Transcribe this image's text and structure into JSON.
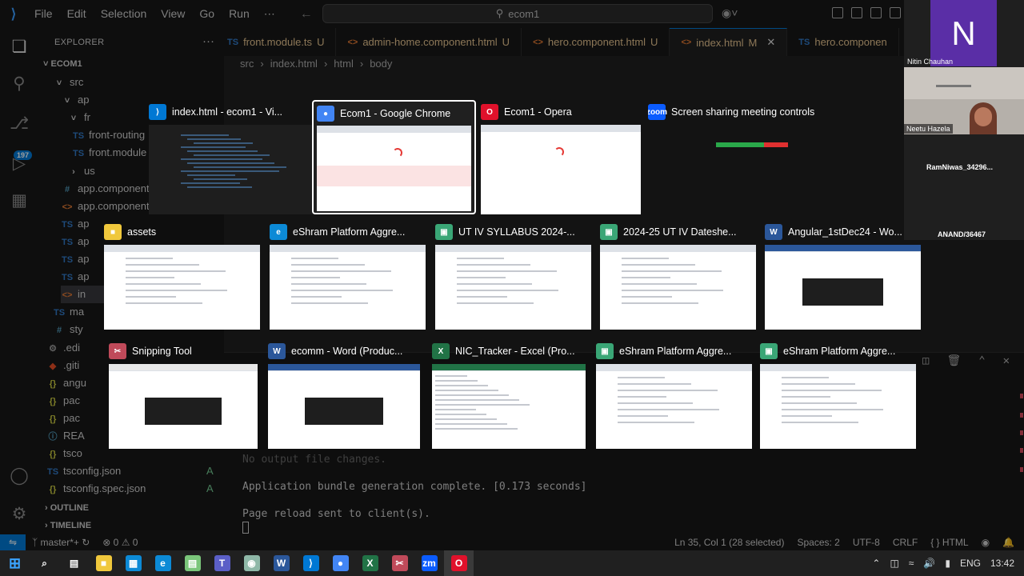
{
  "titlebar": {
    "menu": [
      "File",
      "Edit",
      "Selection",
      "View",
      "Go",
      "Run",
      "⋯"
    ],
    "search": "ecom1"
  },
  "activity": {
    "badge": "197"
  },
  "explorer": {
    "title": "EXPLORER",
    "root": "ECOM1",
    "items": [
      {
        "label": "src",
        "icon": "˅",
        "status": ""
      },
      {
        "label": "ap",
        "icon": "˅",
        "status": ""
      },
      {
        "label": "fr",
        "icon": "˅",
        "status": ""
      },
      {
        "label": "front-routing",
        "icon": "TS",
        "status": ""
      },
      {
        "label": "front.module",
        "icon": "TS",
        "status": ""
      },
      {
        "label": "us",
        "icon": "›",
        "status": ""
      },
      {
        "label": "app.component",
        "icon": "#",
        "status": ""
      },
      {
        "label": "app.component",
        "icon": "<>",
        "status": ""
      },
      {
        "label": "ap",
        "icon": "TS",
        "status": ""
      },
      {
        "label": "ap",
        "icon": "TS",
        "status": ""
      },
      {
        "label": "ap",
        "icon": "TS",
        "status": ""
      },
      {
        "label": "ap",
        "icon": "TS",
        "status": ""
      },
      {
        "label": "in",
        "icon": "<>",
        "status": ""
      },
      {
        "label": "ma",
        "icon": "TS",
        "status": ""
      },
      {
        "label": "sty",
        "icon": "#",
        "status": ""
      },
      {
        "label": ".edi",
        "icon": "⚙",
        "status": ""
      },
      {
        "label": ".giti",
        "icon": "◆",
        "status": ""
      },
      {
        "label": "angu",
        "icon": "{}",
        "status": ""
      },
      {
        "label": "pac",
        "icon": "{}",
        "status": ""
      },
      {
        "label": "pac",
        "icon": "{}",
        "status": ""
      },
      {
        "label": "REA",
        "icon": "ⓘ",
        "status": ""
      },
      {
        "label": "tsco",
        "icon": "{}",
        "status": ""
      },
      {
        "label": "tsconfig.json",
        "icon": "TS",
        "status": "A"
      },
      {
        "label": "tsconfig.spec.json",
        "icon": "{}",
        "status": "A"
      }
    ],
    "outline": "OUTLINE",
    "timeline": "TIMELINE"
  },
  "tabs": [
    {
      "label": "front.module.ts",
      "icon": "TS",
      "status": "U",
      "active": false
    },
    {
      "label": "admin-home.component.html",
      "icon": "<>",
      "status": "U",
      "active": false
    },
    {
      "label": "hero.component.html",
      "icon": "<>",
      "status": "U",
      "active": false
    },
    {
      "label": "index.html",
      "icon": "<>",
      "status": "M",
      "active": true
    },
    {
      "label": "hero.componen",
      "icon": "TS",
      "status": "",
      "active": false
    }
  ],
  "breadcrumb": [
    "src",
    "index.html",
    "html",
    "body"
  ],
  "terminal": {
    "lines": [
      "No output file changes.",
      "Application bundle generation complete. [0.173 seconds]",
      "Page reload sent to client(s)."
    ]
  },
  "statusbar": {
    "branch": "master*+",
    "problems": "⊗ 0 ⚠ 0",
    "position": "Ln 35, Col 1 (28 selected)",
    "spaces": "Spaces: 2",
    "encoding": "UTF-8",
    "eol": "CRLF",
    "language": "{ } HTML"
  },
  "switcher": {
    "windows": [
      {
        "title": "index.html - ecom1 - Vi...",
        "app": "vscode",
        "color": "#0078d4",
        "glyph": "⟩",
        "selected": false
      },
      {
        "title": "Ecom1 - Google Chrome",
        "app": "chrome",
        "color": "#4285f4",
        "glyph": "●",
        "selected": true
      },
      {
        "title": "Ecom1 - Opera",
        "app": "opera",
        "color": "#e0112b",
        "glyph": "O",
        "selected": false
      },
      {
        "title": "Screen sharing meeting controls",
        "app": "zoom",
        "color": "#0b5cff",
        "glyph": "zoom",
        "selected": false
      },
      {
        "title": "assets",
        "app": "explorer",
        "color": "#f0c83c",
        "glyph": "■",
        "selected": false
      },
      {
        "title": "eShram Platform Aggre...",
        "app": "edge",
        "color": "#0c8ad6",
        "glyph": "e",
        "selected": false
      },
      {
        "title": "UT IV SYLLABUS 2024-...",
        "app": "generic",
        "color": "#3aa676",
        "glyph": "▣",
        "selected": false
      },
      {
        "title": "2024-25 UT IV Dateshe...",
        "app": "generic",
        "color": "#3aa676",
        "glyph": "▣",
        "selected": false
      },
      {
        "title": "Angular_1stDec24 - Wo...",
        "app": "word",
        "color": "#2b579a",
        "glyph": "W",
        "selected": false
      },
      {
        "title": "Snipping Tool",
        "app": "snip",
        "color": "#c04a5a",
        "glyph": "✂",
        "selected": false
      },
      {
        "title": "ecomm - Word (Produc...",
        "app": "word",
        "color": "#2b579a",
        "glyph": "W",
        "selected": false
      },
      {
        "title": "NIC_Tracker - Excel (Pro...",
        "app": "excel",
        "color": "#217346",
        "glyph": "X",
        "selected": false
      },
      {
        "title": "eShram Platform Aggre...",
        "app": "generic",
        "color": "#3aa676",
        "glyph": "▣",
        "selected": false
      },
      {
        "title": "eShram Platform Aggre...",
        "app": "generic",
        "color": "#3aa676",
        "glyph": "▣",
        "selected": false
      }
    ]
  },
  "meeting": {
    "host_initial": "N",
    "host_name": "Nitin Chauhan",
    "camera_name": "Neetu Hazela",
    "participants": [
      "RamNiwas_34296...",
      "ANAND/36467"
    ]
  },
  "taskbar": {
    "apps": [
      {
        "name": "search",
        "color": "#fff",
        "glyph": "⌕"
      },
      {
        "name": "task-view",
        "color": "#fff",
        "glyph": "▤"
      },
      {
        "name": "file-explorer",
        "color": "#f0c83c",
        "glyph": "■"
      },
      {
        "name": "store",
        "color": "#0c8ad6",
        "glyph": "▦"
      },
      {
        "name": "edge",
        "color": "#0c8ad6",
        "glyph": "e"
      },
      {
        "name": "notepad",
        "color": "#7bc67b",
        "glyph": "▤"
      },
      {
        "name": "teams",
        "color": "#5b5fc7",
        "glyph": "T"
      },
      {
        "name": "app",
        "color": "#8fb8a8",
        "glyph": "◉"
      },
      {
        "name": "word",
        "color": "#2b579a",
        "glyph": "W"
      },
      {
        "name": "vscode",
        "color": "#0078d4",
        "glyph": "⟩"
      },
      {
        "name": "chrome",
        "color": "#4285f4",
        "glyph": "●"
      },
      {
        "name": "excel",
        "color": "#217346",
        "glyph": "X"
      },
      {
        "name": "snipping",
        "color": "#c04a5a",
        "glyph": "✂"
      },
      {
        "name": "zoom",
        "color": "#0b5cff",
        "glyph": "zm"
      },
      {
        "name": "opera",
        "color": "#e0112b",
        "glyph": "O"
      }
    ],
    "language": "ENG",
    "time": "13:42"
  }
}
